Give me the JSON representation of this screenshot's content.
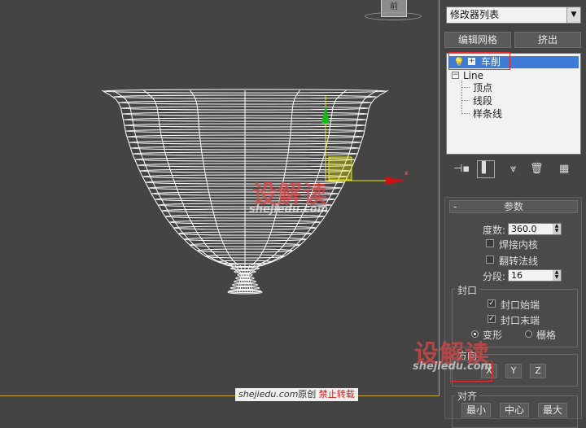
{
  "viewport": {
    "viewcube_label": "前",
    "axis_x_label": "x",
    "watermark_logo": "设解读",
    "watermark_site": "shejiedu.com",
    "credit": {
      "site": "shejiedu.com",
      "original": "原创",
      "forbid": "禁止转载"
    }
  },
  "panel": {
    "modifier_list": "修改器列表",
    "btn_edit_mesh": "编辑网格",
    "btn_extrude": "挤出",
    "stack": {
      "selected": "车削",
      "items": [
        "Line",
        "顶点",
        "线段",
        "样条线"
      ]
    },
    "params": {
      "title": "参数",
      "minus": "-",
      "degrees_label": "度数:",
      "degrees_value": "360.0",
      "weld_core": "焊接内核",
      "flip_normals": "翻转法线",
      "segments_label": "分段:",
      "segments_value": "16",
      "capping": {
        "title": "封口",
        "cap_start": "封口始端",
        "cap_end": "封口末端",
        "morph": "变形",
        "grid": "栅格"
      },
      "direction": {
        "title": "方向",
        "x": "X",
        "y": "Y",
        "z": "Z"
      },
      "align": {
        "title": "对齐",
        "min": "最小",
        "center": "中心",
        "max": "最大"
      }
    }
  },
  "colors": {
    "viewport_bg": "#444444",
    "mesh": "#ffffff",
    "gizmo_x": "#cc1111",
    "gizmo_y": "#11bb11",
    "gizmo_sel": "#e8e800",
    "selection": "#3e7ad6",
    "highlight_box": "#e03030"
  }
}
